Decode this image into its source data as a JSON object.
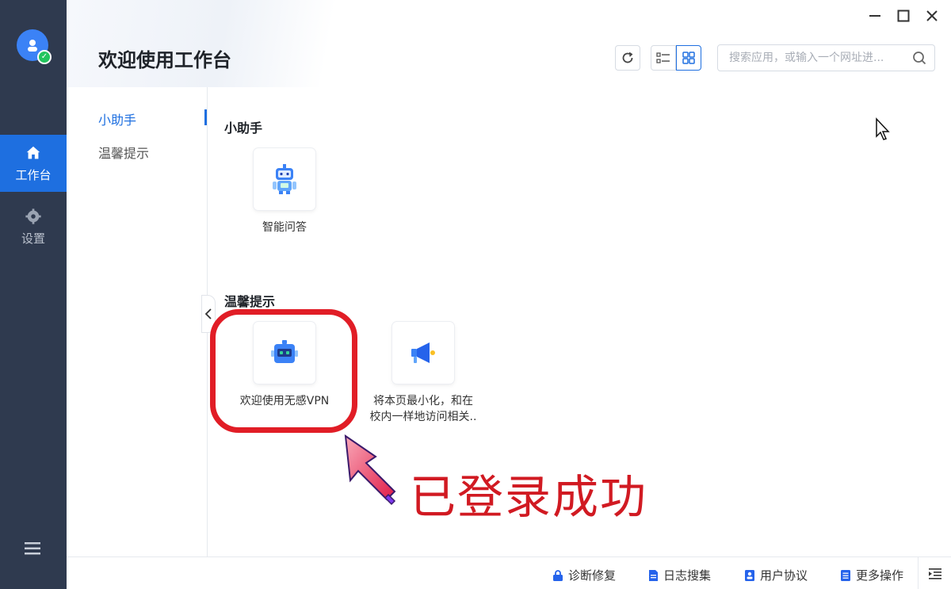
{
  "window": {
    "controls": {
      "minimize": "—",
      "maximize": "☐",
      "close": "✕"
    }
  },
  "header": {
    "title": "欢迎使用工作台",
    "search_placeholder": "搜索应用，或输入一个网址进..."
  },
  "rail": {
    "items": [
      {
        "label": "工作台",
        "icon": "home-icon",
        "active": true
      },
      {
        "label": "设置",
        "icon": "gear-icon",
        "active": false
      }
    ],
    "menu_icon": "menu-icon"
  },
  "subnav": {
    "items": [
      {
        "label": "小助手",
        "active": true
      },
      {
        "label": "温馨提示",
        "active": false
      }
    ]
  },
  "sections": [
    {
      "title": "小助手",
      "apps": [
        {
          "label": "智能问答",
          "icon": "robot-assistant-icon"
        }
      ]
    },
    {
      "title": "温馨提示",
      "apps": [
        {
          "label": "欢迎使用无感VPN",
          "icon": "robot-icon"
        },
        {
          "label_line1": "将本页最小化，和在",
          "label_line2": "校内一样地访问相关..",
          "icon": "megaphone-icon"
        }
      ]
    }
  ],
  "annotation": {
    "text": "已登录成功",
    "color": "#d11a22"
  },
  "footer": {
    "items": [
      {
        "label": "诊断修复",
        "icon": "lock-icon"
      },
      {
        "label": "日志搜集",
        "icon": "document-icon"
      },
      {
        "label": "用户协议",
        "icon": "user-book-icon"
      },
      {
        "label": "更多操作",
        "icon": "list-icon"
      }
    ]
  },
  "colors": {
    "rail_bg": "#2f3a4f",
    "accent": "#1e6fe0",
    "annotation_red": "#e11d26"
  }
}
